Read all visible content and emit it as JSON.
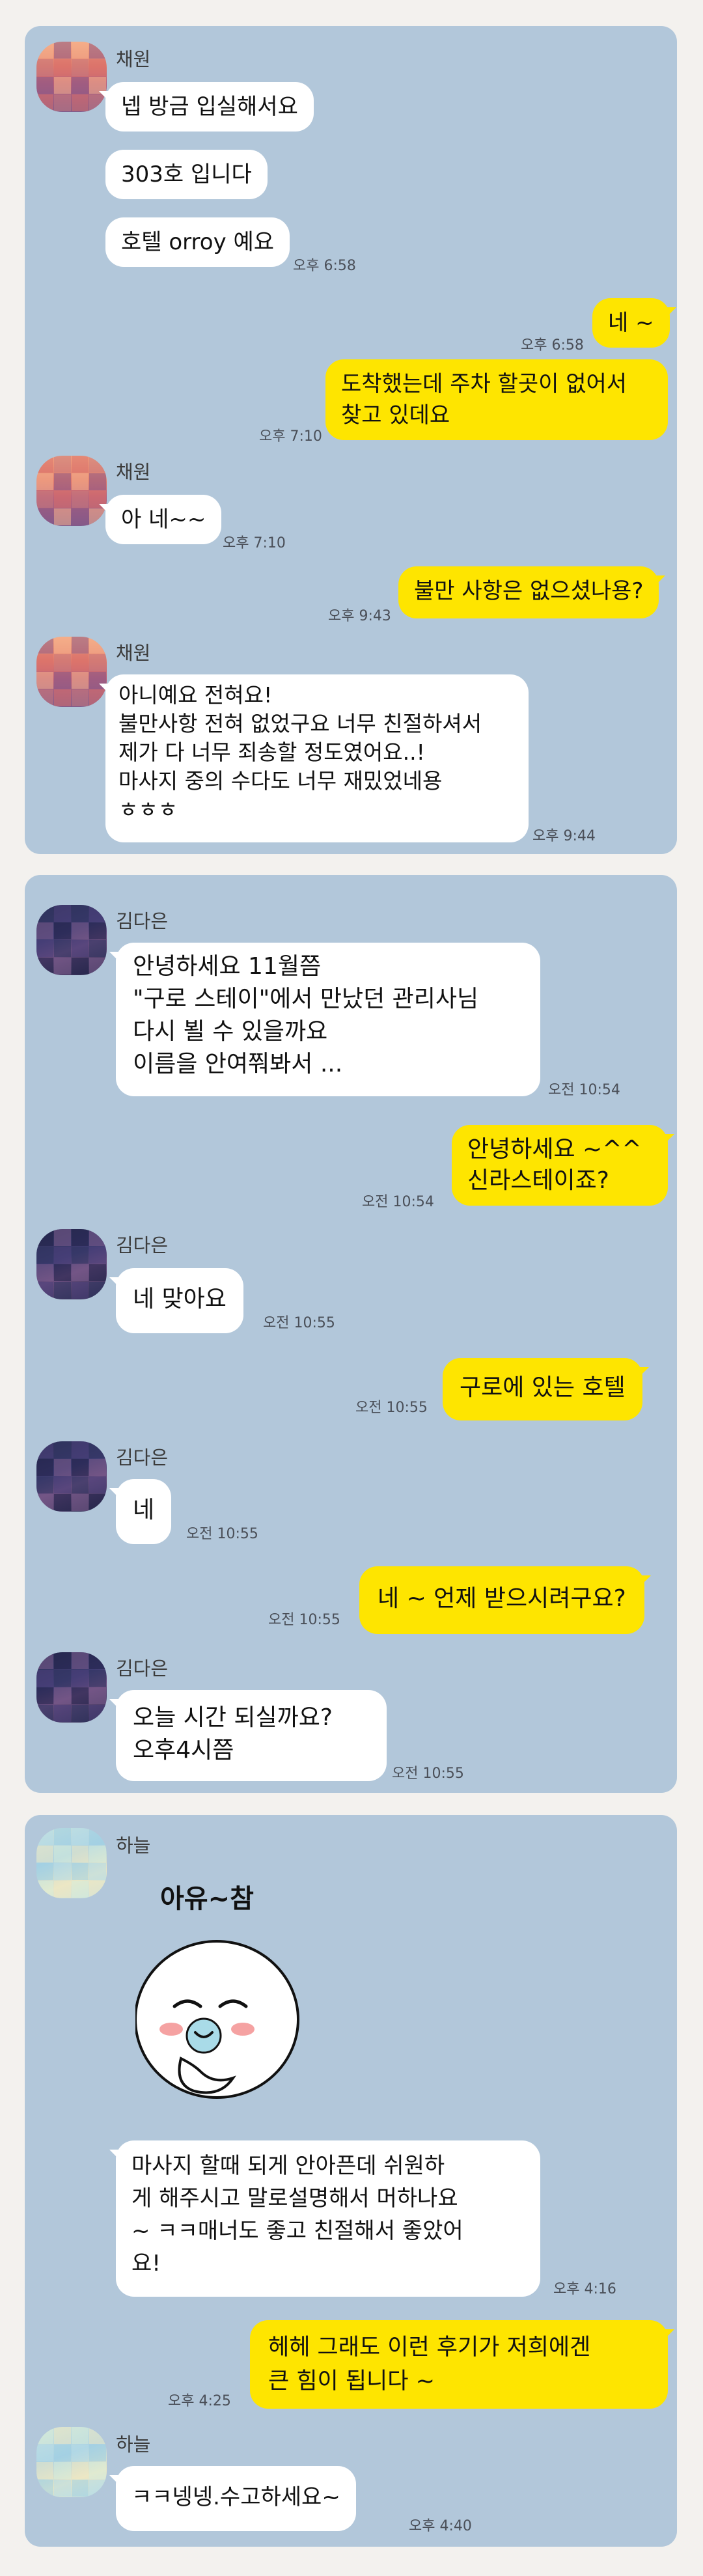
{
  "panels": [
    {
      "name": "채원",
      "messages": [
        {
          "from": "them",
          "text": "넵 방금 입실해서요"
        },
        {
          "from": "them",
          "text": "303호 입니다"
        },
        {
          "from": "them",
          "text": "호텔 orroy 예요",
          "time": "오후 6:58"
        },
        {
          "from": "me",
          "text": "네 ~",
          "time": "오후 6:58"
        },
        {
          "from": "me",
          "text": "도착했는데  주차 할곳이 없어서\n찾고 있데요",
          "time": "오후 7:10"
        },
        {
          "from": "them",
          "text": "아 네~~",
          "time": "오후 7:10"
        },
        {
          "from": "me",
          "text": "불만 사항은 없으셨나용?",
          "time": "오후 9:43"
        },
        {
          "from": "them",
          "text": "아니예요 전혀요!\n불만사항 전혀 없었구요 너무 친절하셔서\n제가 다 너무 죄송할 정도였어요..!\n마사지 중의 수다도 너무 재밌었네용\nㅎㅎㅎ",
          "time": "오후 9:44"
        }
      ]
    },
    {
      "name": "김다은",
      "messages": [
        {
          "from": "them",
          "text": "안녕하세요 11월쯤\n\"구로 스테이\"에서 만났던 관리사님\n다시 뵐 수 있을까요\n이름을 안여쭤봐서 ...",
          "time": "오전 10:54"
        },
        {
          "from": "me",
          "text": "안녕하세요 ~^^\n신라스테이죠?",
          "time": "오전 10:54"
        },
        {
          "from": "them",
          "text": "네 맞아요",
          "time": "오전 10:55"
        },
        {
          "from": "me",
          "text": "구로에 있는 호텔",
          "time": "오전 10:55"
        },
        {
          "from": "them",
          "text": "네",
          "time": "오전 10:55"
        },
        {
          "from": "me",
          "text": "네 ~ 언제 받으시려구요?",
          "time": "오전 10:55"
        },
        {
          "from": "them",
          "text": "오늘  시간 되실까요?\n오후4시쯤",
          "time": "오전 10:55"
        }
      ]
    },
    {
      "name": "하늘",
      "sticker_text": "아유~참",
      "messages": [
        {
          "from": "them",
          "text": "마사지 할때 되게 안아픈데 쉬원하\n게 해주시고 말로설명해서 머하나요\n~ ㅋㅋ매너도 좋고 친절해서 좋았어\n요!",
          "time": "오후 4:16"
        },
        {
          "from": "me",
          "text": "헤헤 그래도 이런 후기가 저희에겐\n큰 힘이 됩니다 ~",
          "time": "오후 4:25"
        },
        {
          "from": "them",
          "text": "ㅋㅋ넹넹.수고하세요~",
          "time": "오후 4:40"
        }
      ]
    }
  ],
  "colors": {
    "chat_bg": "#b2c7da",
    "my_bubble": "#fee500",
    "their_bubble": "#ffffff",
    "page_bg": "#f3f1ee"
  }
}
